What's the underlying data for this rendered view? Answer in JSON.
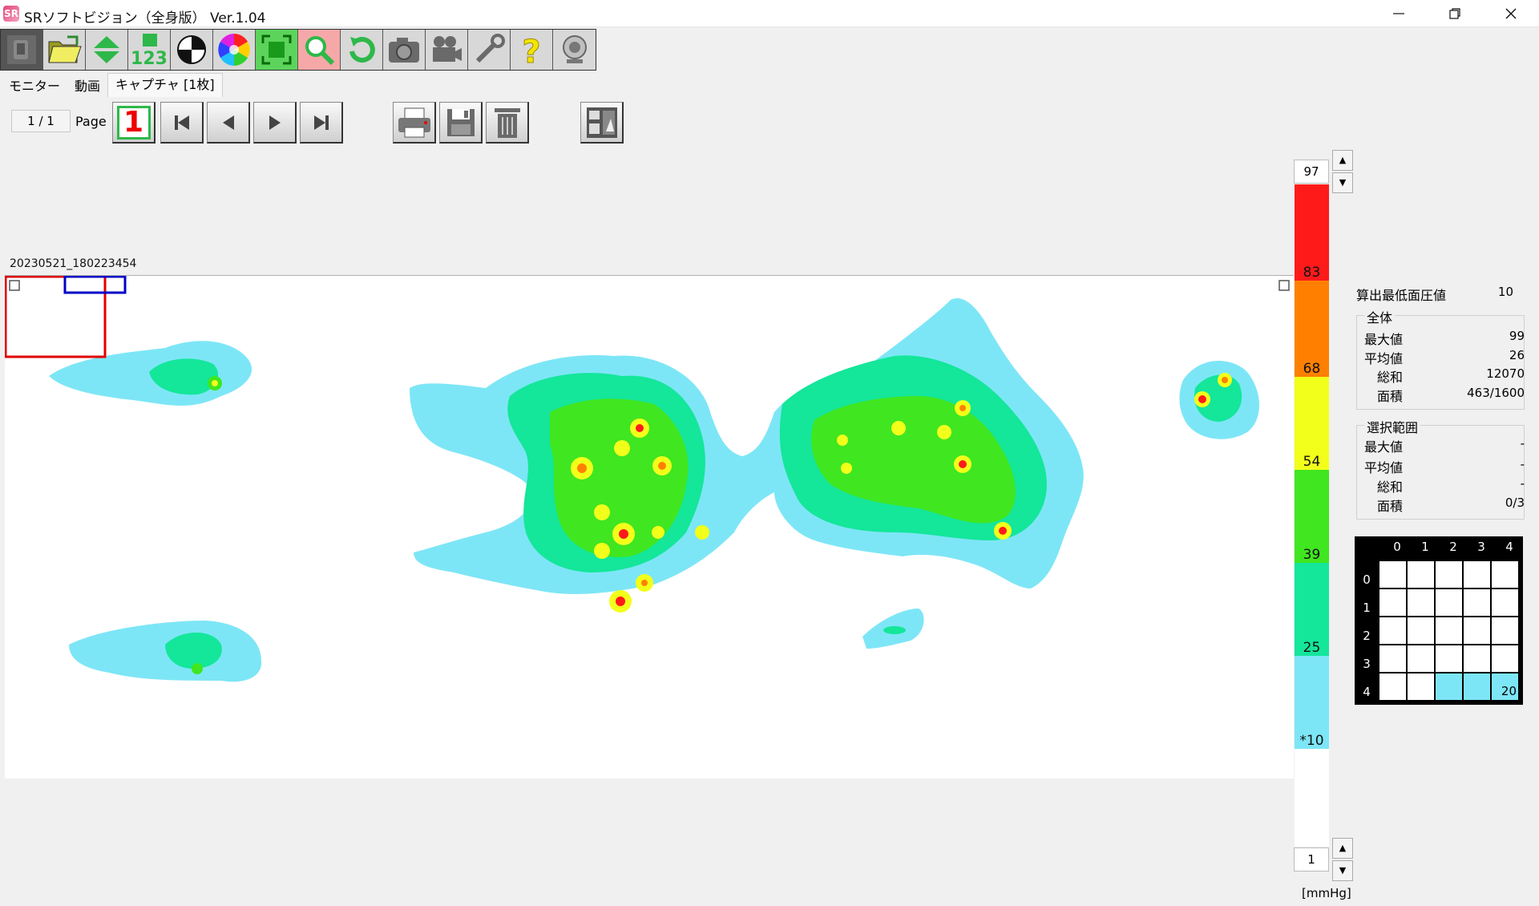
{
  "window": {
    "title": "SRソフトビジョン（全身版） Ver.1.04",
    "icon_text": "SR"
  },
  "toolbar": {
    "buttons": [
      {
        "icon": "sensor-icon"
      },
      {
        "icon": "open-folder-icon"
      },
      {
        "icon": "up-down-arrows-icon"
      },
      {
        "icon": "number-display-icon",
        "text": "123"
      },
      {
        "icon": "center-of-pressure-icon"
      },
      {
        "icon": "color-wheel-icon"
      },
      {
        "icon": "fit-frame-icon"
      },
      {
        "icon": "magnifier-icon"
      },
      {
        "icon": "rotate-icon"
      },
      {
        "icon": "camera-icon"
      },
      {
        "icon": "movie-camera-icon"
      },
      {
        "icon": "wrench-icon"
      },
      {
        "icon": "help-icon",
        "text": "?"
      },
      {
        "icon": "webcam-icon"
      }
    ]
  },
  "tabs": [
    "モニター",
    "動画",
    "キャプチャ [1枚]"
  ],
  "active_tab": 2,
  "page_controls": {
    "page_value": "1 / 1",
    "page_label": "Page",
    "one_button_label": "1"
  },
  "capture": {
    "timestamp": "20230521_180223454"
  },
  "scale": {
    "max_value": "97",
    "min_value": "1",
    "unit": "[mmHg]",
    "labels": [
      "83",
      "68",
      "54",
      "39",
      "25",
      "*10"
    ],
    "colors": {
      "red": "#ff1a1a",
      "orange": "#ff8000",
      "yellow": "#f2ff1a",
      "green": "#40e620",
      "teal": "#14e69a",
      "cyan": "#7de6f6"
    }
  },
  "stats": {
    "min_pressure_label": "算出最低面圧値",
    "min_pressure_value": "10",
    "overall": {
      "title": "全体",
      "rows": [
        {
          "label": "最大値",
          "value": "99"
        },
        {
          "label": "平均値",
          "value": "26"
        },
        {
          "label": "総和",
          "value": "12070"
        },
        {
          "label": "面積",
          "value": "463/1600"
        }
      ]
    },
    "selection": {
      "title": "選択範囲",
      "rows": [
        {
          "label": "最大値",
          "value": "-"
        },
        {
          "label": "平均値",
          "value": "-"
        },
        {
          "label": "総和",
          "value": "-"
        },
        {
          "label": "面積",
          "value": "0/3"
        }
      ]
    }
  },
  "grid": {
    "col_headers": [
      "0",
      "1",
      "2",
      "3",
      "4"
    ],
    "row_headers": [
      "0",
      "1",
      "2",
      "3",
      "4"
    ],
    "highlight_value": "20"
  }
}
